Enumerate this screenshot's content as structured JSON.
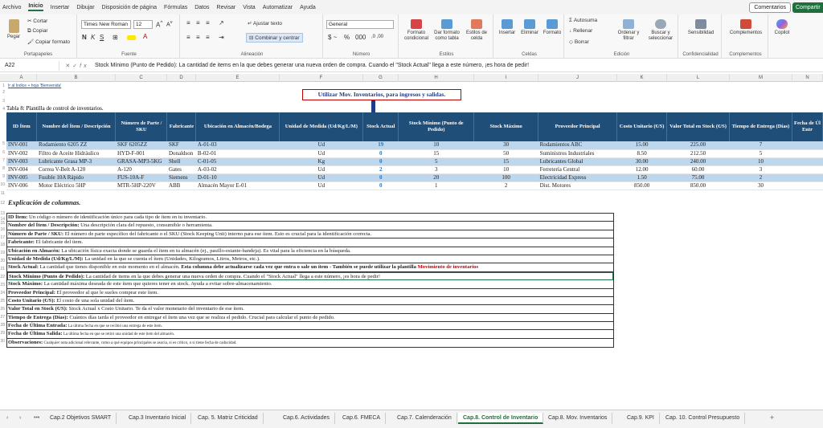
{
  "menu": {
    "items": [
      "Archivo",
      "Inicio",
      "Insertar",
      "Dibujar",
      "Disposición de página",
      "Fórmulas",
      "Datos",
      "Revisar",
      "Vista",
      "Automatizar",
      "Ayuda"
    ],
    "comments": "Comentarios",
    "share": "Compartir"
  },
  "ribbon": {
    "paste": "Pegar",
    "cut": "Cortar",
    "copy": "Copiar",
    "format_painter": "Copiar formato",
    "group_clipboard": "Portapapeles",
    "font_name": "Times New Roman",
    "font_size": "12",
    "group_font": "Fuente",
    "wrap_text": "Ajustar texto",
    "merge_center": "Combinar y centrar",
    "group_alignment": "Alineación",
    "number_format": "General",
    "group_number": "Número",
    "cond_format": "Formato condicional",
    "format_table": "Dar formato como tabla",
    "cell_styles": "Estilos de celda",
    "group_styles": "Estilos",
    "insert": "Insertar",
    "delete": "Eliminar",
    "format": "Formato",
    "group_cells": "Celdas",
    "autosum": "Autosuma",
    "fill": "Rellenar",
    "clear": "Borrar",
    "sort_filter": "Ordenar y filtrar",
    "find_select": "Buscar y seleccionar",
    "group_editing": "Edición",
    "sensitivity": "Sensibilidad",
    "group_confidentiality": "Confidencialidad",
    "addins": "Complementos",
    "group_addins": "Complementos",
    "copilot": "Copilot"
  },
  "formula_bar": {
    "name_box": "A22",
    "fx": "fx",
    "content": "Stock Mínimo (Punto de Pedido): La cantidad de items en la que debes generar una nueva orden de compra. Cuando el \"Stock Actual\" llega a este número, ¡es hora de pedir!"
  },
  "columns": [
    "A",
    "B",
    "C",
    "D",
    "E",
    "F",
    "G",
    "H",
    "I",
    "J",
    "K",
    "L",
    "M",
    "N"
  ],
  "row_numbers": [
    "1",
    "2",
    "3",
    "4",
    "5",
    "6",
    "7",
    "8",
    "9",
    "10",
    "11",
    "12",
    "13",
    "14",
    "15",
    "16",
    "17",
    "18",
    "19",
    "20",
    "21",
    "22",
    "23",
    "24",
    "25",
    "26",
    "27",
    "28",
    "29",
    "30"
  ],
  "sheet": {
    "link": "Ir al Índice + hoja 'Bienvenida'",
    "callout": "Utilizar Mov. Inventarios, para ingresos y salidas.",
    "table_title": "Tabla 8: Plantilla de control de inventarios.",
    "headers": [
      "ID Ítem",
      "Nombre del Ítem / Descripción",
      "Número de Parte / SKU",
      "Fabricante",
      "Ubicación en Almacén/Bodega",
      "Unidad de Medida (Ud/Kg/L/M)",
      "Stock Actual",
      "Stock Mínimo (Punto de Pedido)",
      "Stock Máximo",
      "Proveedor Principal",
      "Costo Unitario (€/S)",
      "Valor Total en Stock (€/S)",
      "Tiempo de Entrega (Días)",
      "Fecha de Úl Entr"
    ],
    "rows": [
      [
        "INV-001",
        "Rodamiento 6205 ZZ",
        "SKF 6205ZZ",
        "SKF",
        "A-01-03",
        "Ud",
        "19",
        "10",
        "30",
        "Rodamientos ABC",
        "15.00",
        "225.00",
        "7",
        ""
      ],
      [
        "INV-002",
        "Filtro de Aceite Hidráulico",
        "HYD-F-001",
        "Donaldson",
        "B-02-01",
        "Ud",
        "0",
        "15",
        "50",
        "Suministros Industriales",
        "8.50",
        "212.50",
        "5",
        ""
      ],
      [
        "INV-003",
        "Lubricante Grasa MP-3",
        "GRASA-MP3-5KG",
        "Shell",
        "C-01-05",
        "Kg",
        "0",
        "5",
        "15",
        "Lubricantes Global",
        "30.00",
        "240.00",
        "10",
        ""
      ],
      [
        "INV-004",
        "Correa V-Belt A-120",
        "A-120",
        "Gates",
        "A-03-02",
        "Ud",
        "2",
        "3",
        "10",
        "Ferretería Central",
        "12.00",
        "60.00",
        "3",
        ""
      ],
      [
        "INV-005",
        "Fusible 10A Rápido",
        "FUS-10A-F",
        "Siemens",
        "D-01-10",
        "Ud",
        "0",
        "20",
        "100",
        "Electricidad Express",
        "1.50",
        "75.00",
        "2",
        ""
      ],
      [
        "INV-006",
        "Motor Eléctrico 5HP",
        "MTR-5HP-220V",
        "ABB",
        "Almacén Mayor E-01",
        "Ud",
        "0",
        "1",
        "2",
        "Dist. Motores",
        "850.00",
        "850.00",
        "30",
        ""
      ]
    ],
    "explanation_title": "Explicación de columnas.",
    "explanations": [
      {
        "term": "ID Ítem:",
        "text": " Un código o número de identificación único para cada tipo de ítem en tu inventario.",
        "small": false
      },
      {
        "term": "Nombre del Ítem / Descripción:",
        "text": " Una descripción clara del repuesto, consumible o herramienta.",
        "small": false
      },
      {
        "term": "Número de Parte / SKU:",
        "text": " El número de parte específico del fabricante o el SKU (Stock Keeping Unit) interno para ese ítem. Esto es crucial para la identificación correcta.",
        "small": false
      },
      {
        "term": "Fabricante:",
        "text": " El fabricante del ítem.",
        "small": false
      },
      {
        "term": "Ubicación en Almacén:",
        "text": " La ubicación física exacta donde se guarda el ítem en tu almacén (ej., pasillo-estante-bandeja). Es vital para la eficiencia en la búsqueda.",
        "small": false
      },
      {
        "term": "Unidad de Medida (Ud/Kg/L/M):",
        "text": " La unidad en la que se cuenta el ítem (Unidades, Kilogramos, Litros, Metros, etc.).",
        "small": false
      },
      {
        "term": "Stock Actual:",
        "text": " La cantidad que tienes disponible en este momento en el almacén. ",
        "bold_tail": "Esta columna debe actualizarse cada vez que entra o sale un ítem - También se puede utilizar la plantilla ",
        "red": "Movimiento de inventarios",
        "small": false
      },
      {
        "term": "Stock Mínimo (Punto de Pedido):",
        "text": " La cantidad de items en la que debes generar una nueva orden de compra. Cuando el \"Stock Actual\" llega a este número, ¡es hora de pedir!",
        "small": false,
        "selected": true
      },
      {
        "term": "Stock Máximo:",
        "text": " La cantidad máxima deseada de este ítem que quieres tener en stock. Ayuda a evitar sobre-almacenamiento.",
        "small": false
      },
      {
        "term": "Proveedor Principal:",
        "text": " El proveedor al que le sueles comprar este ítem.",
        "small": false
      },
      {
        "term": "Costo Unitario (€/S):",
        "text": " El costo de una sola unidad del ítem.",
        "small": false
      },
      {
        "term": "Valor Total en Stock (€/S):",
        "text": " Stock Actual x Costo Unitario. Te da el valor monetario del inventario de ese ítem.",
        "small": false
      },
      {
        "term": "Tiempo de Entrega (Días):",
        "text": " Cuántos días tarda el proveedor en entregar el ítem una vez que se realiza el pedido. Crucial para calcular el punto de pedido.",
        "small": false
      },
      {
        "term": "Fecha de Última Entrada:",
        "text": " La última fecha en que se recibió una entrega de este ítem.",
        "small": true
      },
      {
        "term": "Fecha de Última Salida:",
        "text": " La última fecha en que se retiró una unidad de este ítem del almacén.",
        "small": true
      },
      {
        "term": "Observaciones:",
        "text": " Cualquier nota adicional relevante, como a qué equipos principales se asocia, si es crítico, o si tiene fecha de caducidad.",
        "small": true
      }
    ]
  },
  "tabs": {
    "nav_prev": "‹",
    "nav_next": "›",
    "more": "•••",
    "items": [
      "Cap.2 Objetivos SMART",
      "Cap.3 Inventario Inicial",
      "Cap. 5. Matriz Criticidad",
      "Cap.6. Actividades",
      "Cap.6. FMECA",
      "Cap.7. Calenderación",
      "Cap.8. Control de Inventario",
      "Cap.8. Mov. Inventarios",
      "Cap.9. KPI",
      "Cap. 10. Control Presupuesto"
    ],
    "active": "Cap.8. Control de Inventario",
    "add": "+"
  },
  "colors": {
    "header_blue": "#1f4e79",
    "row_band": "#bdd7ee",
    "excel_green": "#1f6e3c",
    "stock_blue": "#2e75b6",
    "callout_red": "#c00000"
  }
}
